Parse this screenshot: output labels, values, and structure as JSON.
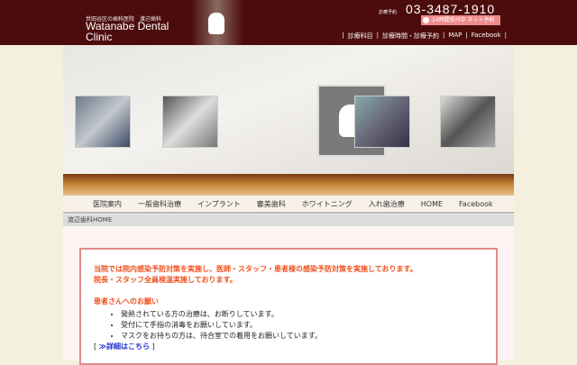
{
  "header": {
    "subtitle": "世田谷区の歯科医院　渡辺歯科",
    "clinic_name_line1": "Watanabe Dental",
    "clinic_name_line2": "Clinic",
    "tel_label": "診療予約",
    "tel": "03-3487-1910",
    "net_booking": "24時間受付中 ネット予約",
    "links": [
      "|",
      "診療科目",
      "|",
      "診療時間・診療予約",
      "|",
      "MAP",
      "|",
      "Facebook",
      "|"
    ]
  },
  "nav": [
    "医院案内",
    "一般歯科治療",
    "インプラント",
    "審美歯科",
    "ホワイトニング",
    "入れ歯治療",
    "HOME",
    "Facebook"
  ],
  "breadcrumb": "渡辺歯科HOME",
  "notice": {
    "line1": "当院では院内感染予防対策を実施し、医師・スタッフ・患者様の感染予防対策を実施しております。",
    "line2": "院長・スタッフ全員検温実施しております。",
    "heading": "患者さんへのお願い",
    "items": [
      "発熱されている方の治療は、お断りしています。",
      "受付にて手指の消毒をお願いしています。",
      "マスクをお持ちの方は、待合室での着用をお願いしています。"
    ],
    "more_open": "[",
    "more_link": "≫詳細はこちら",
    "more_close": "]"
  }
}
